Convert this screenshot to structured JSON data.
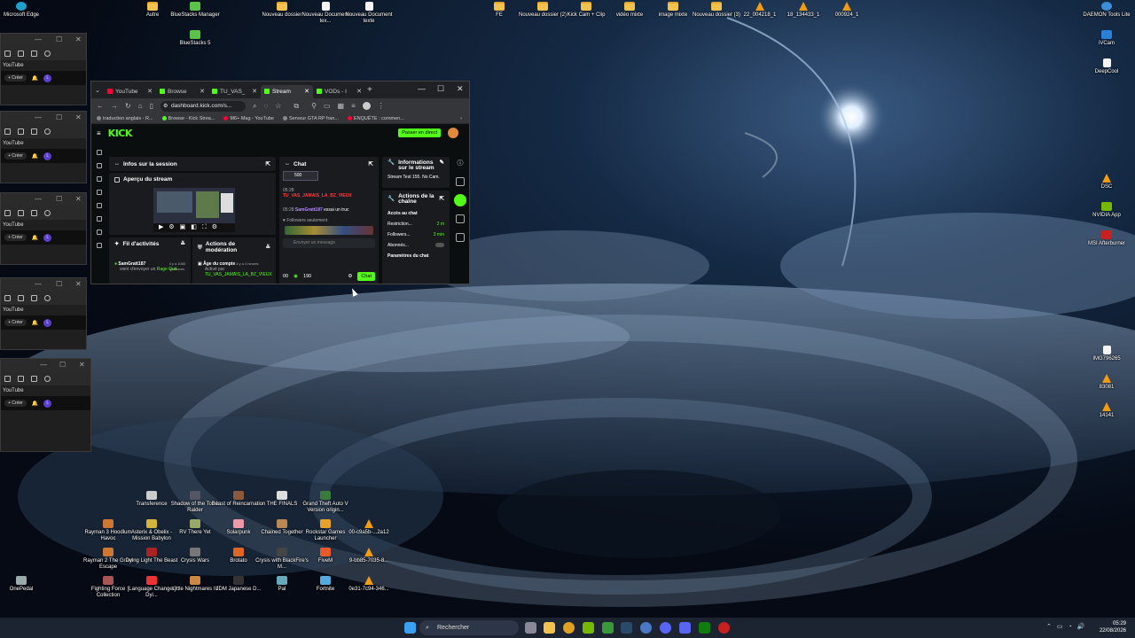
{
  "desktop": {
    "icons_top": [
      "Microsoft Edge",
      "Autre",
      "BlueStacks Manager",
      "BlueStacks 5",
      "Nouveau dossier",
      "Nouveau Document tex...",
      "Nouveau Document texte",
      "FE",
      "Nouveau dossier (2)",
      "Kick Cam + Clip",
      "vidéo mixte",
      "image mixte",
      "Nouveau dossier (3)",
      "22_004218_1",
      "18_134433_1",
      "000924_1",
      "DAEMON Tools Lite",
      "iVCam",
      "DeepCool"
    ],
    "icons_right": [
      "DSC",
      "NVIDIA App",
      "MSI Afterburner",
      "IMG796265",
      "83081",
      "14141"
    ],
    "icons_bottom": [
      "Transference",
      "Shadow of the Tomb Raider",
      "Beast of Reincarnation",
      "THE FINALS",
      "Grand Theft Auto V Version origin...",
      "Rayman 3 Hoodlum Havoc",
      "Asterix & Obelix - Mission Babylon",
      "RV There Yet",
      "Solarpunk",
      "Chained Together",
      "Rockstar Games Launcher",
      "00-c9a5b-...2a12",
      "Rayman 2 The Great Escape",
      "Dying Light The Beast",
      "Crysis Wars",
      "Brotato",
      "Crysis with BlackFire's M...",
      "FiveM",
      "9-bb85-7035-8...",
      "Fighting Force Collection",
      "[Language Changer] Dyi...",
      "Little Nightmares III",
      "JDM Japanese D...",
      "Pal",
      "Fortnite",
      "0e31-7c94-346...",
      "OnePedal"
    ]
  },
  "ghost_windows": {
    "youtube_label": "YouTube",
    "create_label": "+ Créer",
    "avatar_letter": "L"
  },
  "browser": {
    "tabs": [
      {
        "label": "YouTube",
        "color": "#ff0033"
      },
      {
        "label": "Browse",
        "color": "#53fc18"
      },
      {
        "label": "TU_VAS_",
        "color": "#53fc18"
      },
      {
        "label": "Stream",
        "color": "#53fc18"
      },
      {
        "label": "VODs - I",
        "color": "#53fc18"
      }
    ],
    "new_tab": "+",
    "url": "dashboard.kick.com/s...",
    "bookmarks": [
      "traduction anglais - R...",
      "Browse - Kick Strea...",
      "M6+ Mag - YouTube",
      "Serveur GTA RP fran...",
      "ENQUÊTE : commen..."
    ]
  },
  "kick": {
    "logo": "KICK",
    "go_live": "Passer en direct",
    "session_title": "Infos sur la session",
    "preview_title": "Aperçu du stream",
    "activity_title": "Fil d'activités",
    "activity_user": "SamGratt187",
    "activity_text": "vient d'envoyer un",
    "activity_item": "Rage Quit",
    "activity_time": "il y a 1060 semaines",
    "mod_title": "Actions de modération",
    "mod_item": "Âge du compte",
    "mod_time": "il y a 4 heures",
    "mod_by": "Activé par",
    "mod_user": "TU_VAS_JAMAIS_LA_BZ_VIEUX",
    "chat_title": "Chat",
    "chat_badge": "500",
    "chat_time1": "05:28",
    "chat_user1": "TU_VAS_JAMAIS_LA_BZ_VIEUX",
    "chat_time2": "05:28",
    "chat_user2": "SamGratt187",
    "chat_msg2": "essai un truc",
    "chat_followers_note": "Followers seulement",
    "chat_placeholder": "Envoyer un message",
    "chat_viewers": "00",
    "chat_points": "190",
    "chat_button": "Chat",
    "info_title": "Informations sur le stream",
    "info_stream": "Stream Test 155. No Cam.",
    "channel_title": "Actions de la chaîne",
    "access_title": "Accès au chat",
    "restriction_label": "Restriction...",
    "restriction_value": "2 m",
    "followers_label": "Followers...",
    "followers_value": "3 min",
    "subs_label": "Abonnés...",
    "params_label": "Paramètres du chat"
  },
  "taskbar": {
    "search": "Rechercher",
    "time": "05:29",
    "date": "22/08/2026"
  }
}
